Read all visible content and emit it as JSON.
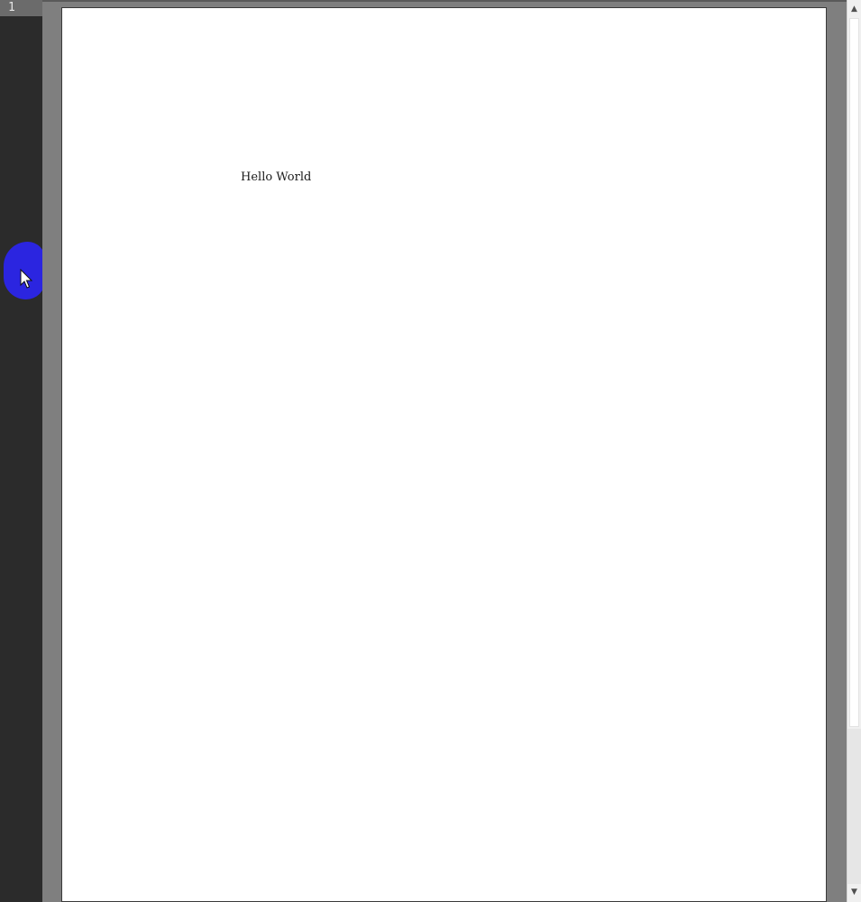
{
  "editor": {
    "line_numbers": [
      "1"
    ]
  },
  "viewer": {
    "page_text": "Hello World"
  },
  "icons": {
    "pointer": "mouse-pointer-icon",
    "scroll_up": "scroll-up-arrow-icon",
    "scroll_down": "scroll-down-arrow-icon"
  },
  "colors": {
    "gutter": "#2b2b2b",
    "viewer_background": "#7f7f7f",
    "page": "#ffffff",
    "cursor_highlight": "#2b25e0"
  }
}
